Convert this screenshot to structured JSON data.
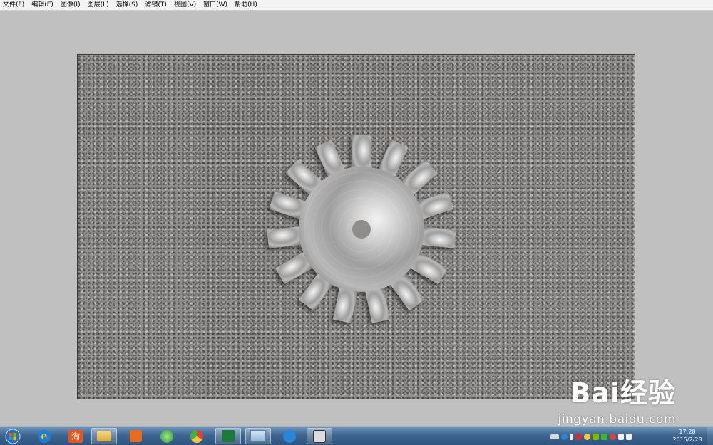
{
  "menubar": {
    "items": [
      "文件(F)",
      "编辑(E)",
      "图像(I)",
      "图层(L)",
      "选择(S)",
      "滤镜(T)",
      "视图(V)",
      "窗口(W)",
      "帮助(H)"
    ]
  },
  "canvas": {
    "content": "metal-gear-on-granite"
  },
  "watermark": {
    "logo_text": "Bai经验",
    "url": "jingyan.baidu.com"
  },
  "taskbar": {
    "apps": [
      {
        "name": "internet-explorer-icon",
        "color": "#1e7fd6"
      },
      {
        "name": "taobao-icon",
        "color": "#e8541e",
        "glyph": "淘"
      },
      {
        "name": "file-explorer-icon",
        "color": "#e8c25a"
      },
      {
        "name": "media-player-icon",
        "color": "#e86b1e"
      },
      {
        "name": "browser-360-icon",
        "color": "#3cb43c"
      },
      {
        "name": "chrome-icon",
        "color": "#d9443a"
      },
      {
        "name": "excel-icon",
        "color": "#1d7a3a"
      },
      {
        "name": "window-app-icon",
        "color": "#8fb6d8"
      },
      {
        "name": "qq-browser-icon",
        "color": "#2a86d8"
      },
      {
        "name": "image-editor-icon",
        "color": "#333333"
      }
    ],
    "clock_time": "17:28",
    "clock_date": "2015/2/28"
  },
  "colors": {
    "workspace": "#c0c0c0",
    "taskbar": "#3d6590"
  }
}
